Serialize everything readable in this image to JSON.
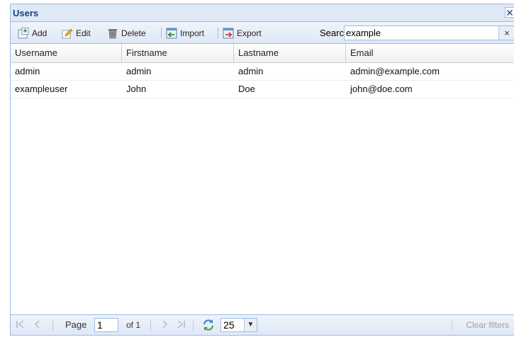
{
  "window": {
    "title": "Users",
    "close_label": "✕"
  },
  "toolbar": {
    "add_label": "Add",
    "edit_label": "Edit",
    "delete_label": "Delete",
    "import_label": "Import",
    "export_label": "Export",
    "search_label": "Search",
    "search_value": "example",
    "search_clear": "×"
  },
  "grid": {
    "columns": [
      "Username",
      "Firstname",
      "Lastname",
      "Email"
    ],
    "rows": [
      [
        "admin",
        "admin",
        "admin",
        "admin@example.com"
      ],
      [
        "exampleuser",
        "John",
        "Doe",
        "john@doe.com"
      ]
    ]
  },
  "pager": {
    "page_label": "Page",
    "page_value": "1",
    "of_label": "of 1",
    "page_size": "25",
    "clear_filters": "Clear filters"
  },
  "colors": {
    "header_bg": "#dfe8f6",
    "border": "#99bbe8",
    "title": "#15428b"
  },
  "icons": [
    "add-icon",
    "edit-icon",
    "delete-icon",
    "import-icon",
    "export-icon",
    "first-page-icon",
    "prev-page-icon",
    "next-page-icon",
    "last-page-icon",
    "refresh-icon"
  ]
}
